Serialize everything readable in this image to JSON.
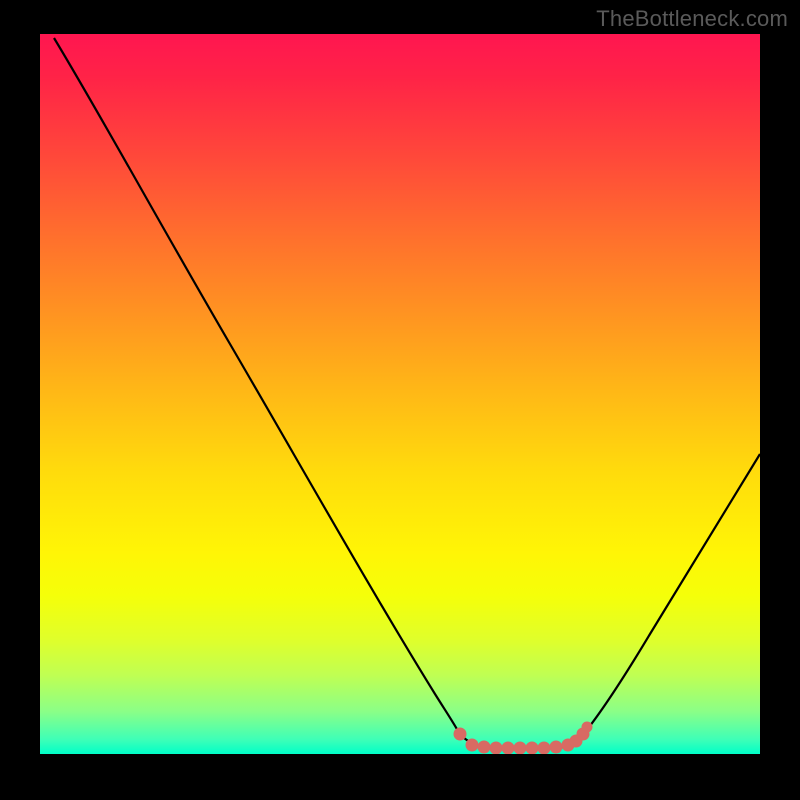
{
  "watermark": "TheBottleneck.com",
  "chart_data": {
    "type": "line",
    "title": "",
    "xlabel": "",
    "ylabel": "",
    "x_range": [
      0,
      100
    ],
    "y_range": [
      0,
      100
    ],
    "background_gradient": {
      "top": "#ff1650",
      "bottom": "#00ffc8",
      "meaning": "high(red) to low(green) bottleneck"
    },
    "series": [
      {
        "name": "bottleneck-curve",
        "color": "#000000",
        "x": [
          2,
          10,
          20,
          30,
          40,
          50,
          55,
          58,
          60,
          64,
          70,
          74,
          76,
          80,
          86,
          92,
          100
        ],
        "y": [
          99,
          86,
          71,
          55,
          40,
          24,
          15,
          7,
          2,
          0,
          0,
          0,
          2,
          7,
          18,
          31,
          48
        ]
      },
      {
        "name": "highlight-band",
        "color": "#e07068",
        "note": "flat minimum region near y≈0",
        "x": [
          58,
          60,
          64,
          70,
          74,
          76
        ],
        "y": [
          3,
          1,
          0,
          0,
          0.5,
          2
        ]
      }
    ],
    "annotations": []
  }
}
